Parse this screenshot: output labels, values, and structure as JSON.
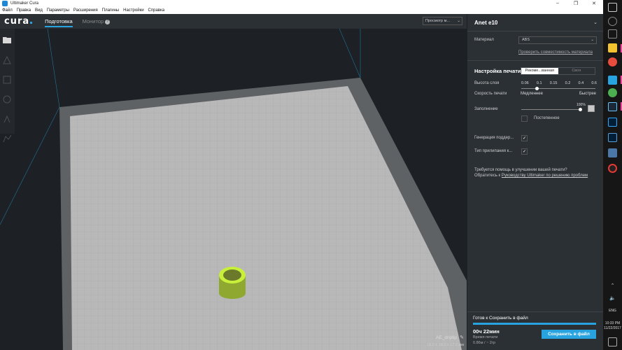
{
  "window": {
    "title": "Ultimaker Cura"
  },
  "menu": [
    "Файл",
    "Правка",
    "Вид",
    "Параметры",
    "Расширения",
    "Плагины",
    "Настройки",
    "Справка"
  ],
  "header": {
    "logo": "cura",
    "tab_prepare": "Подготовка",
    "tab_monitor": "Монитор",
    "view_mode": "Просмотр м..."
  },
  "viewport": {
    "object_name": "AE_driptip",
    "object_dims": "18.0 x 18.0 x 17.0 мм"
  },
  "panel": {
    "printer": "Anet e10",
    "material_label": "Материал",
    "material_value": "ABS",
    "compat_link": "Проверить совместимость материала",
    "print_settings_title": "Настройка печати",
    "mode_recommended": "Рекоме...ванная",
    "mode_custom": "Своя",
    "layer_height_label": "Высота слоя",
    "layer_ticks": [
      "0.06",
      "0.1",
      "0.15",
      "0.2",
      "0.4",
      "0.6"
    ],
    "print_speed_label": "Скорость печати",
    "slow": "Медленнее",
    "fast": "Быстрее",
    "infill_label": "Заполнение",
    "infill_pct": "100%",
    "infill_value": 1.0,
    "gradual_label": "Постепенное",
    "support_label": "Генерация поддер...",
    "adhesion_label": "Тип прилипания к...",
    "help_line1": "Требуется помощь в улучшении вашей печати?",
    "help_line2_prefix": "Обратитесь к ",
    "help_link": "Руководству Ultimaker по решению проблем",
    "save_status": "Готов к Сохранить в файл",
    "print_time": "00ч 22мин",
    "print_time_label": "Время печати",
    "material_usage": "0.86м / ~ 2гр",
    "save_button": "Сохранить в файл"
  },
  "taskbar": {
    "lang": "ENG",
    "time": "10:33 PM",
    "date": "11/22/2017"
  },
  "colors": {
    "accent": "#29a3e0",
    "model": "#c8f03a",
    "panel_bg": "#2b3035",
    "viewport_bg": "#1d2024"
  }
}
